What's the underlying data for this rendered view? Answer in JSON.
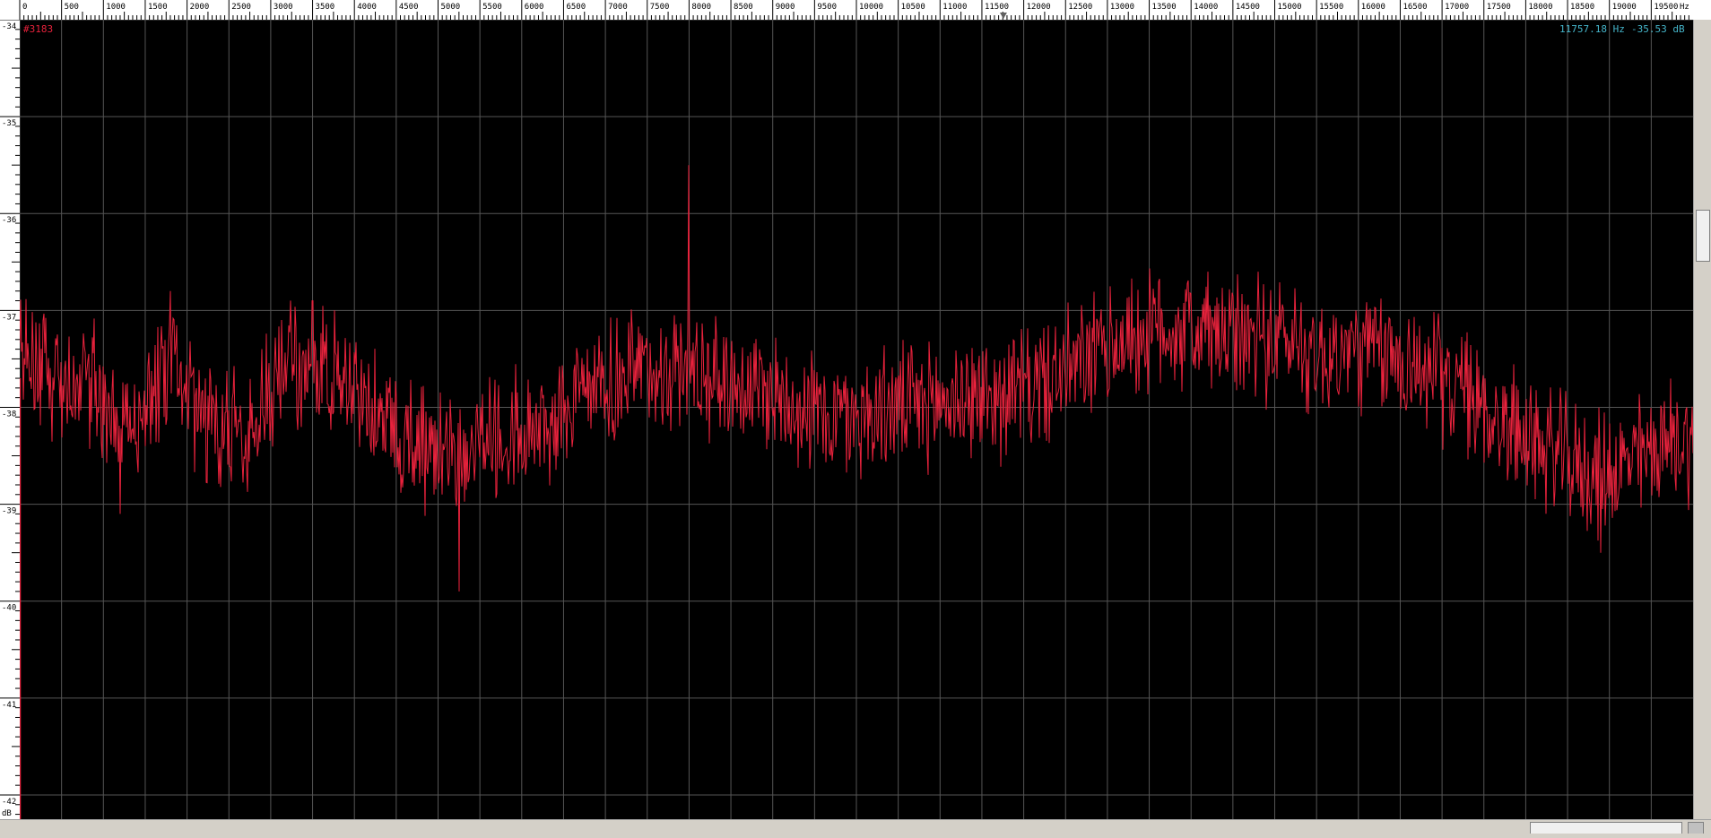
{
  "chart_data": {
    "type": "line",
    "x_unit": "Hz",
    "y_unit": "dB",
    "xlim": [
      0,
      20000
    ],
    "ylim": [
      -42.25,
      -34
    ],
    "x_tick_labels": [
      "0",
      "500",
      "1000",
      "1500",
      "2000",
      "2500",
      "3000",
      "3500",
      "4000",
      "4500",
      "5000",
      "5500",
      "6000",
      "6500",
      "7000",
      "7500",
      "8000",
      "8500",
      "9000",
      "9500",
      "10000",
      "10500",
      "11000",
      "11500",
      "12000",
      "12500",
      "13000",
      "13500",
      "14000",
      "14500",
      "15000",
      "15500",
      "16000",
      "16500",
      "17000",
      "17500",
      "18000",
      "18500",
      "19000",
      "19500"
    ],
    "x_tick_values": [
      0,
      500,
      1000,
      1500,
      2000,
      2500,
      3000,
      3500,
      4000,
      4500,
      5000,
      5500,
      6000,
      6500,
      7000,
      7500,
      8000,
      8500,
      9000,
      9500,
      10000,
      10500,
      11000,
      11500,
      12000,
      12500,
      13000,
      13500,
      14000,
      14500,
      15000,
      15500,
      16000,
      16500,
      17000,
      17500,
      18000,
      18500,
      19000,
      19500
    ],
    "y_tick_labels": [
      "-34",
      "-35",
      "-36",
      "-37",
      "-38",
      "-39",
      "-40",
      "-41",
      "-42"
    ],
    "y_tick_values": [
      -34,
      -35,
      -36,
      -37,
      -38,
      -39,
      -40,
      -41,
      -42
    ],
    "grid": true,
    "series": [
      {
        "color": "#e8223c",
        "envelope": {
          "x": [
            0,
            300,
            600,
            900,
            1200,
            1500,
            1800,
            2000,
            2400,
            2800,
            3200,
            3600,
            4000,
            4400,
            4800,
            5200,
            5600,
            6000,
            6400,
            6800,
            7200,
            7600,
            8000,
            8400,
            8800,
            9200,
            9600,
            10000,
            10400,
            10800,
            11200,
            11600,
            12000,
            12400,
            12800,
            13200,
            13600,
            14000,
            14400,
            14800,
            15200,
            15600,
            16000,
            16400,
            16800,
            17200,
            17600,
            18000,
            18400,
            18800,
            19200,
            19600,
            20000
          ],
          "y": [
            -37.5,
            -37.6,
            -37.8,
            -37.7,
            -38.4,
            -37.9,
            -37.4,
            -37.9,
            -38.2,
            -38.2,
            -37.6,
            -37.6,
            -37.8,
            -38.2,
            -38.4,
            -38.5,
            -38.3,
            -38.3,
            -38.1,
            -37.9,
            -37.7,
            -37.6,
            -37.6,
            -37.7,
            -37.8,
            -37.9,
            -38.1,
            -38.1,
            -38.0,
            -38.0,
            -37.9,
            -37.9,
            -37.8,
            -37.7,
            -37.5,
            -37.3,
            -37.2,
            -37.2,
            -37.3,
            -37.3,
            -37.3,
            -37.5,
            -37.4,
            -37.5,
            -37.6,
            -37.8,
            -38.1,
            -38.3,
            -38.5,
            -38.7,
            -38.6,
            -38.4,
            -38.3
          ]
        },
        "noise_amplitude_db": 0.55,
        "peaks": [
          {
            "x": 8000,
            "y": -35.5
          },
          {
            "x": 1800,
            "y": -36.8
          },
          {
            "x": 3500,
            "y": -36.9
          },
          {
            "x": 14200,
            "y": -36.6
          },
          {
            "x": 14800,
            "y": -36.6
          }
        ],
        "dips": [
          {
            "x": 5250,
            "y": -39.9
          },
          {
            "x": 1200,
            "y": -39.1
          },
          {
            "x": 18900,
            "y": -39.5
          }
        ]
      }
    ]
  },
  "overlay": {
    "position_label": "#3183",
    "cursor_freq": "11757.18 Hz",
    "cursor_db": "-35.53 dB",
    "x_axis_unit": "Hz",
    "y_axis_unit": "dB",
    "cursor_freq_value": 11757.18
  },
  "colors": {
    "background": "#000000",
    "grid": "#555555",
    "spectrum": "#e8223c",
    "readout": "#45b5ca",
    "position_label": "#e8223c",
    "ruler": "#ffffff"
  }
}
